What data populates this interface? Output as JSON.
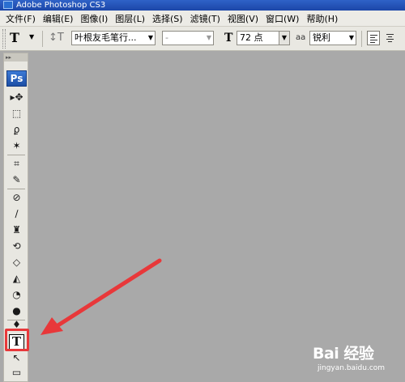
{
  "window": {
    "title": "Adobe Photoshop CS3"
  },
  "menubar": {
    "items": [
      "文件(F)",
      "编辑(E)",
      "图像(I)",
      "图层(L)",
      "选择(S)",
      "滤镜(T)",
      "视图(V)",
      "窗口(W)",
      "帮助(H)"
    ]
  },
  "options_bar": {
    "tool_glyph": "T",
    "font_family": "叶根友毛笔行...",
    "font_style": "-",
    "font_size": "72 点",
    "antialias_label": "aa",
    "antialias_mode": "锐利"
  },
  "toolbox": {
    "header": "▸▸",
    "ps_logo": "Ps",
    "type_tool_glyph": "T",
    "tools": [
      "move-tool",
      "marquee-tool",
      "lasso-tool",
      "magic-wand-tool",
      "crop-tool",
      "slice-tool",
      "healing-brush-tool",
      "brush-tool",
      "clone-stamp-tool",
      "history-brush-tool",
      "eraser-tool",
      "paint-bucket-tool",
      "blur-tool",
      "dodge-tool",
      "pen-tool",
      "type-tool",
      "path-selection-tool",
      "shape-tool"
    ]
  },
  "annotation": {
    "highlight_color": "#e8383a",
    "target": "type-tool"
  },
  "watermark": {
    "logo": "Bai  经验",
    "url": "jingyan.baidu.com"
  }
}
